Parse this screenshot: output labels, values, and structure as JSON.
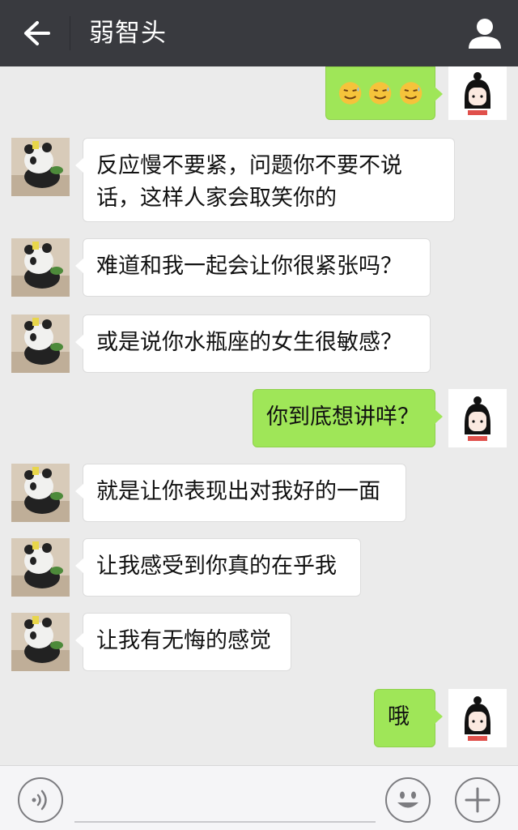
{
  "header": {
    "title": "弱智头",
    "back_icon": "arrow-left-icon",
    "profile_icon": "person-icon",
    "background": "#393a3f"
  },
  "colors": {
    "sent_bubble": "#9fe658",
    "received_bubble": "#ffffff",
    "chat_background": "#ebebeb"
  },
  "messages": [
    {
      "side": "right",
      "type": "emoji",
      "emoji": [
        "sweat-smile",
        "sweat-smile",
        "sweat-smile"
      ]
    },
    {
      "side": "left",
      "text": "反应慢不要紧，问题你不要不说话，这样人家会取笑你的"
    },
    {
      "side": "left",
      "text": "难道和我一起会让你很紧张吗？"
    },
    {
      "side": "left",
      "text": "或是说你水瓶座的女生很敏感？"
    },
    {
      "side": "right",
      "text": "你到底想讲咩？"
    },
    {
      "side": "left",
      "text": "就是让你表现出对我好的一面"
    },
    {
      "side": "left",
      "text": "让我感受到你真的在乎我"
    },
    {
      "side": "left",
      "text": "让我有无悔的感觉"
    },
    {
      "side": "right",
      "text": "哦"
    }
  ],
  "input_bar": {
    "voice_icon": "voice-icon",
    "emoji_icon": "smiley-face-icon",
    "plus_icon": "plus-icon",
    "input_value": ""
  }
}
